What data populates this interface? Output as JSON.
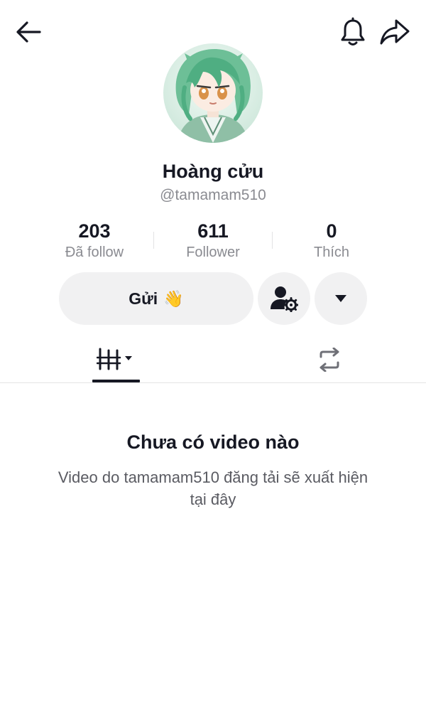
{
  "header": {
    "back_icon": "arrow-left-icon",
    "bell_icon": "bell-icon",
    "share_icon": "share-arrow-icon"
  },
  "profile": {
    "display_name": "Hoàng cửu",
    "username": "@tamamam510",
    "avatar_icon": "avatar-image"
  },
  "stats": [
    {
      "value": "203",
      "label": "Đã follow"
    },
    {
      "value": "611",
      "label": "Follower"
    },
    {
      "value": "0",
      "label": "Thích"
    }
  ],
  "actions": {
    "send_label": "Gửi",
    "send_emoji": "👋",
    "friend_icon": "user-settings-icon",
    "more_icon": "caret-down-icon"
  },
  "tabs": {
    "videos_icon": "video-grid-icon",
    "repost_icon": "repost-icon"
  },
  "empty_state": {
    "title": "Chưa có video nào",
    "description": "Video do tamamam510 đăng tải sẽ xuất hiện tại đây"
  },
  "colors": {
    "text_primary": "#161823",
    "text_secondary": "#8a8b91",
    "button_bg": "#f1f1f2",
    "divider": "#e3e3e4"
  }
}
